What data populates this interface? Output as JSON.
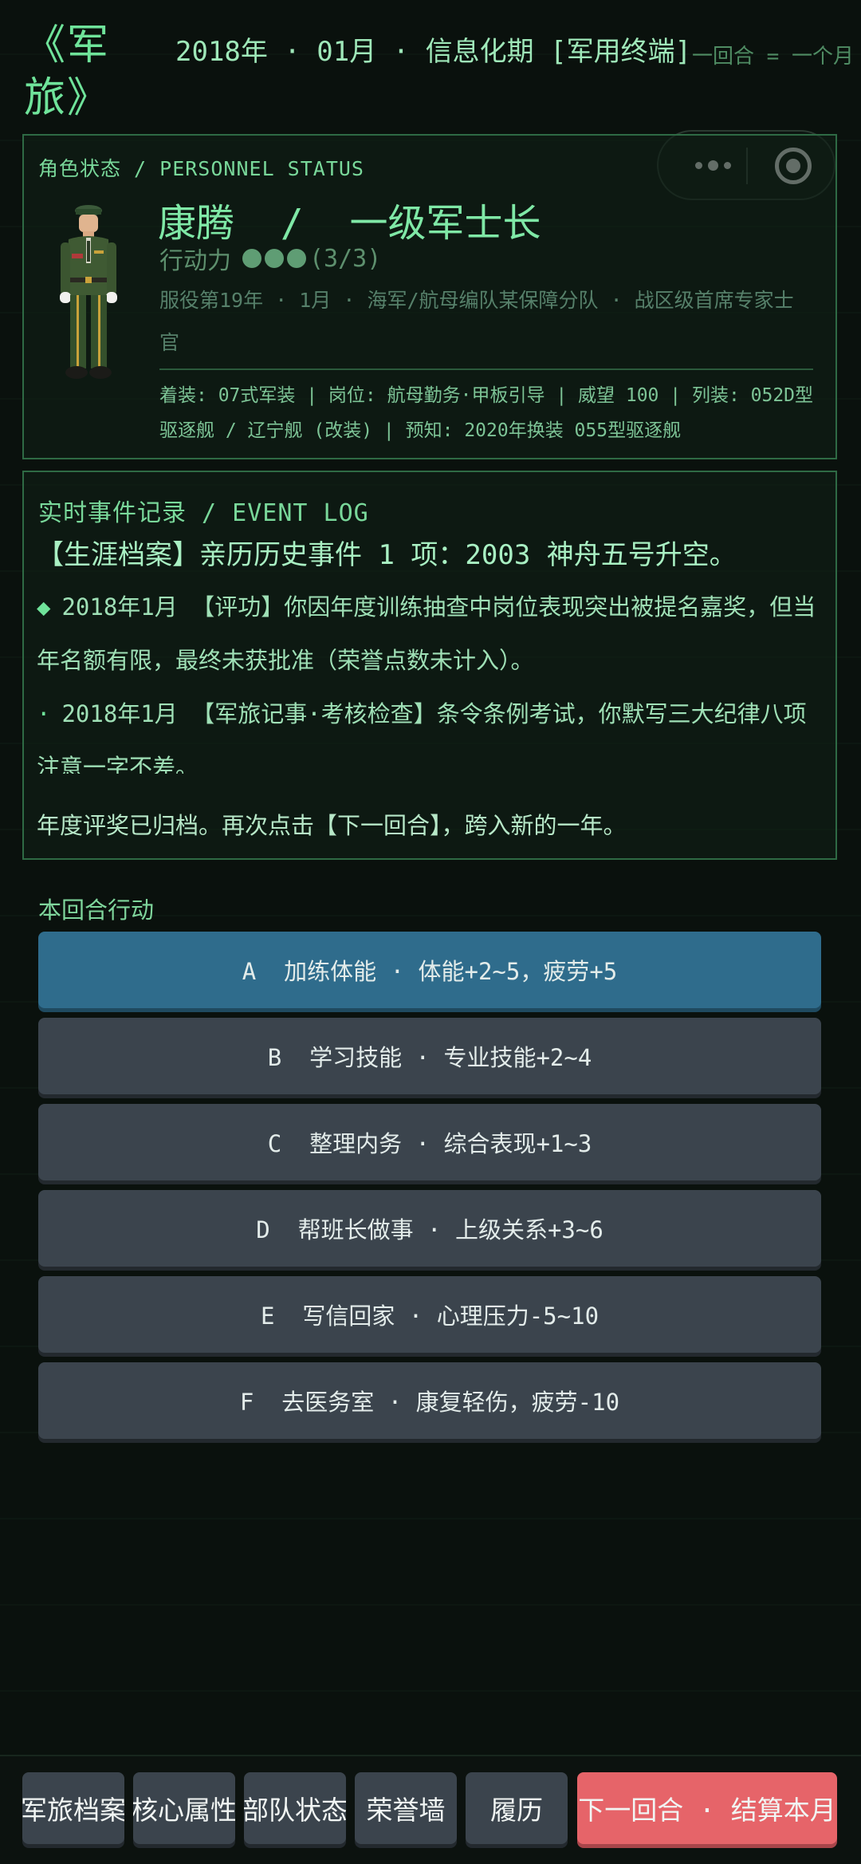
{
  "header": {
    "brand": "《军旅》",
    "date": "2018年 · 01月 · 信息化期 [军用终端]",
    "turn_note": "一回合 = 一个月"
  },
  "status_panel": {
    "title": "角色状态 / PERSONNEL STATUS",
    "name_rank": "康腾  /  一级军士长",
    "action_label": "行动力",
    "action_points": 3,
    "action_max": 3,
    "action_count": "(3/3)",
    "service": "服役第19年 · 1月 · 海军/航母编队某保障分队 · 战区级首席专家士官",
    "detail": "着装: 07式军装 | 岗位: 航母勤务·甲板引导 | 威望 100 | 列装: 052D型驱逐舰 / 辽宁舰 (改装) | 预知: 2020年换装 055型驱逐舰"
  },
  "log_panel": {
    "title": "实时事件记录 / EVENT LOG",
    "headline": "【生涯档案】亲历历史事件 1 项：2003 神舟五号升空。",
    "entries": [
      {
        "marker": "◆",
        "text": "2018年1月 【评功】你因年度训练抽查中岗位表现突出被提名嘉奖，但当年名额有限，最终未获批准（荣誉点数未计入）。"
      },
      {
        "marker": "·",
        "text": "2018年1月 【军旅记事·考核检查】条令条例考试，你默写三大纪律八项注意一字不差。"
      }
    ],
    "footer": "年度评奖已归档。再次点击【下一回合】，跨入新的一年。"
  },
  "actions": {
    "title": "本回合行动",
    "items": [
      {
        "label": "A  加练体能 · 体能+2~5，疲劳+5",
        "active": true
      },
      {
        "label": "B  学习技能 · 专业技能+2~4",
        "active": false
      },
      {
        "label": "C  整理内务 · 综合表现+1~3",
        "active": false
      },
      {
        "label": "D  帮班长做事 · 上级关系+3~6",
        "active": false
      },
      {
        "label": "E  写信回家 · 心理压力-5~10",
        "active": false
      },
      {
        "label": "F  去医务室 · 康复轻伤，疲劳-10",
        "active": false
      }
    ]
  },
  "bottom_nav": {
    "tabs": [
      "军旅档案",
      "核心属性",
      "部队状态",
      "荣誉墙",
      "履历"
    ],
    "next": "下一回合 · 结算本月"
  },
  "colors": {
    "accent": "#6fe39a",
    "active_action": "#2f6c8c",
    "button": "#3b444d",
    "next_button": "#e66469"
  }
}
